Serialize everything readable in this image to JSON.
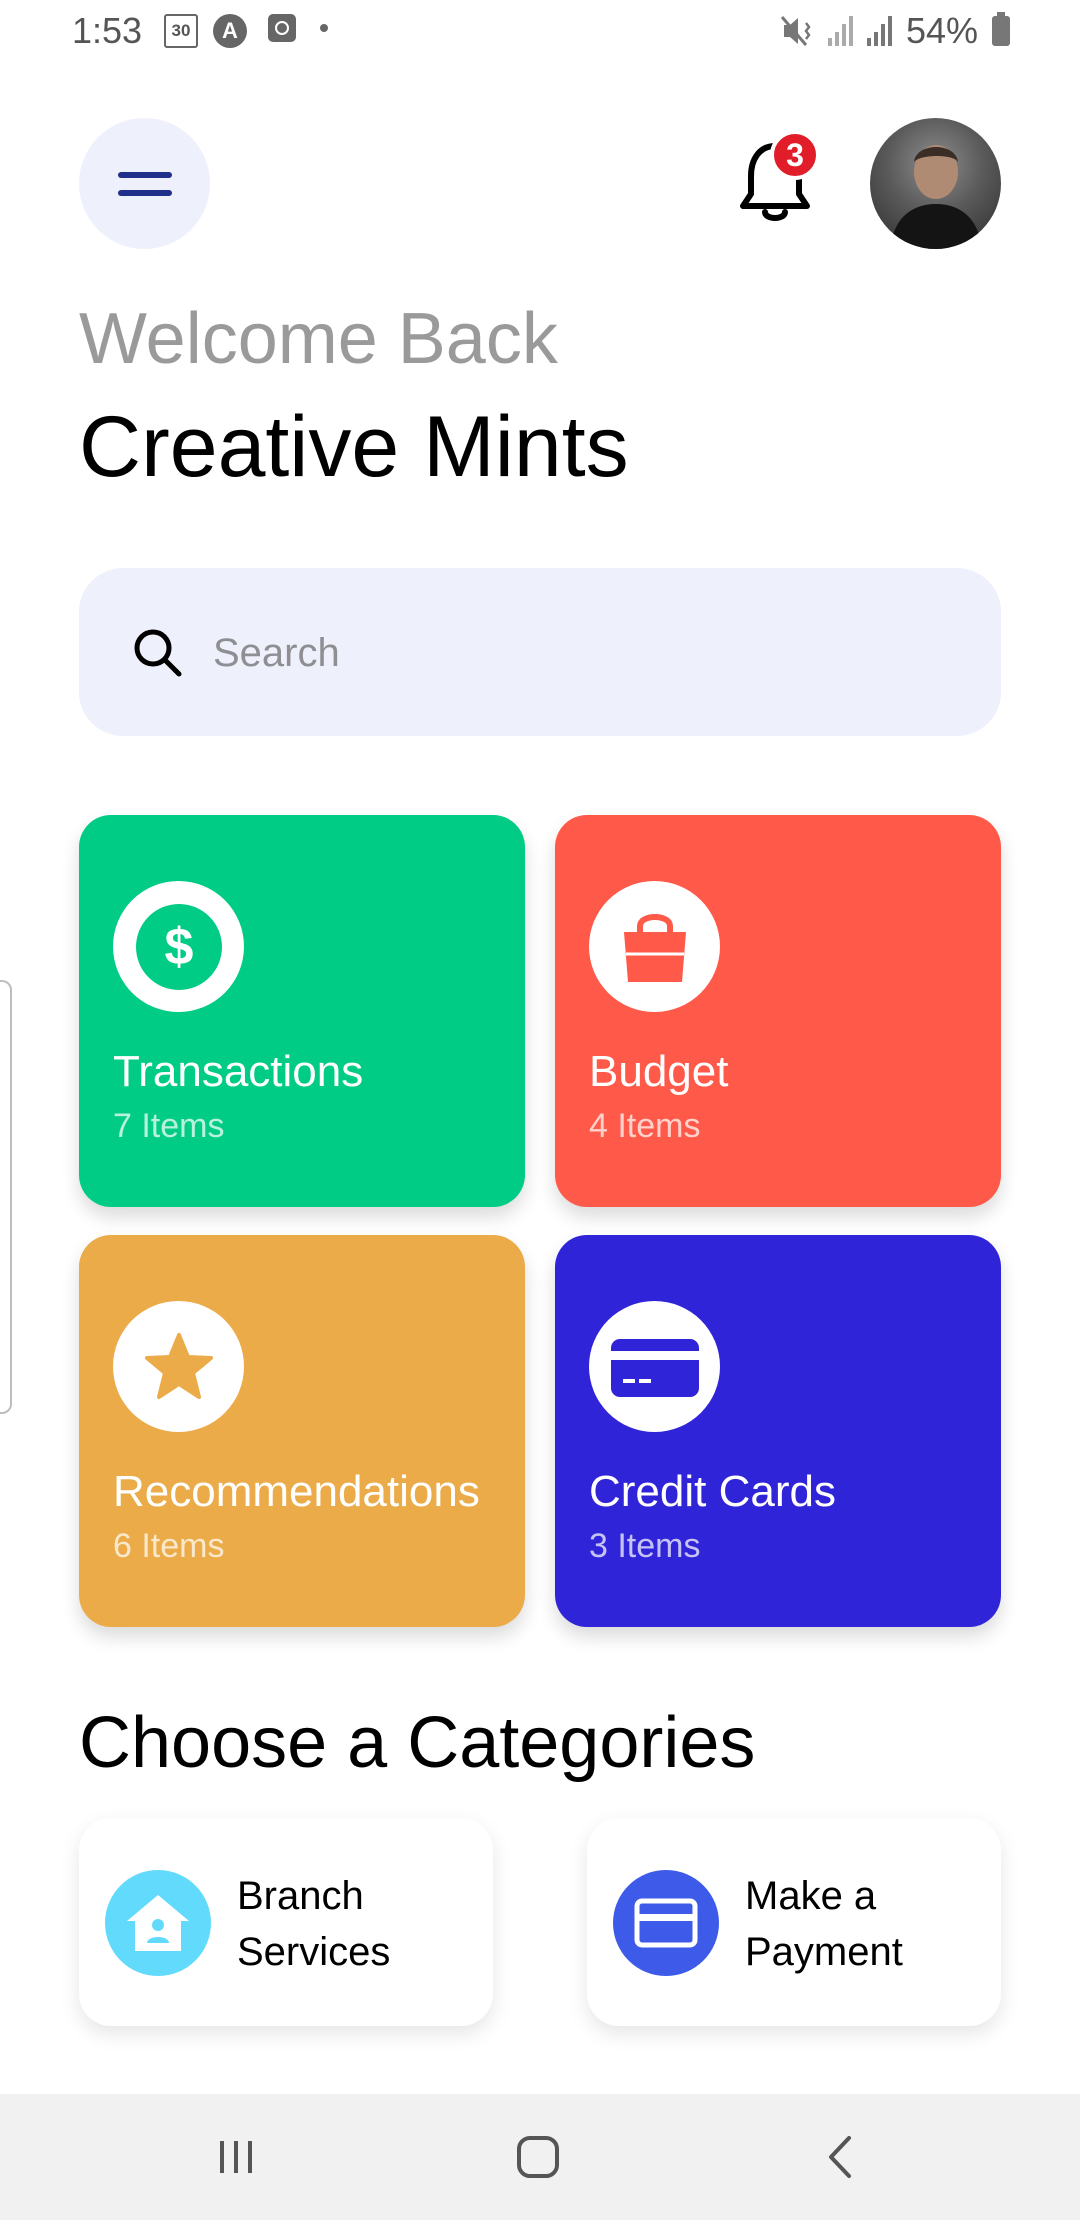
{
  "status_bar": {
    "time": "1:53",
    "calendar_badge": "30",
    "a_badge": "A",
    "battery": "54%"
  },
  "header": {
    "notification_count": "3"
  },
  "greeting": {
    "welcome": "Welcome Back",
    "name": "Creative Mints"
  },
  "search": {
    "placeholder": "Search",
    "value": ""
  },
  "tiles": [
    {
      "title": "Transactions",
      "subtitle": "7 Items",
      "color": "#00cc85",
      "icon": "dollar-coin-icon"
    },
    {
      "title": "Budget",
      "subtitle": "4 Items",
      "color": "#ff5a49",
      "icon": "shopping-bag-icon"
    },
    {
      "title": "Recommendations",
      "subtitle": "6 Items",
      "color": "#ebab48",
      "icon": "star-icon"
    },
    {
      "title": "Credit Cards",
      "subtitle": "3 Items",
      "color": "#3024d8",
      "icon": "credit-card-icon"
    }
  ],
  "categories": {
    "title": "Choose a Categories",
    "items": [
      {
        "line1": "Branch",
        "line2": "Services",
        "color": "#62dafc",
        "icon": "branch-house-icon"
      },
      {
        "line1": "Make a",
        "line2": "Payment",
        "color": "#3d5be8",
        "icon": "payment-card-icon"
      }
    ]
  }
}
